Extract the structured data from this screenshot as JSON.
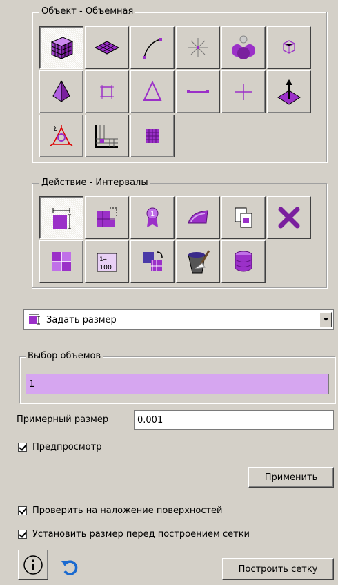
{
  "object_group": {
    "title": "Объект - Объемная",
    "tools": [
      {
        "name": "volume-cube-icon",
        "active": true
      },
      {
        "name": "surface-icon",
        "active": false
      },
      {
        "name": "curve-icon",
        "active": false
      },
      {
        "name": "vertex-icon",
        "active": false
      },
      {
        "name": "group-icon",
        "active": false
      },
      {
        "name": "polyhedron-icon",
        "active": false
      },
      {
        "name": "cone-icon",
        "active": false
      },
      {
        "name": "square-icon",
        "active": false
      },
      {
        "name": "triangle-icon",
        "active": false
      },
      {
        "name": "edge-icon",
        "active": false
      },
      {
        "name": "node-icon",
        "active": false
      },
      {
        "name": "extrude-icon",
        "active": false
      },
      {
        "name": "sum-triangle-icon",
        "active": false
      },
      {
        "name": "mesh-corner-icon",
        "active": false
      },
      {
        "name": "grid-icon",
        "active": false
      }
    ]
  },
  "action_group": {
    "title": "Действие - Интервалы",
    "tools": [
      {
        "name": "set-size-icon",
        "active": true
      },
      {
        "name": "split-block-icon",
        "active": false
      },
      {
        "name": "badge-icon",
        "active": false
      },
      {
        "name": "iron-icon",
        "active": false
      },
      {
        "name": "copy-icon",
        "active": false
      },
      {
        "name": "delete-x-icon",
        "active": false
      },
      {
        "name": "quadrants-icon",
        "active": false
      },
      {
        "name": "interval-count-icon",
        "active": false
      },
      {
        "name": "transfer-icon",
        "active": false
      },
      {
        "name": "brush-bucket-icon",
        "active": false
      },
      {
        "name": "database-icon",
        "active": false
      }
    ],
    "count_label": "1→\n100"
  },
  "operation_select": {
    "value": "Задать размер"
  },
  "volume_select": {
    "title": "Выбор объемов",
    "value": "1"
  },
  "approx_size": {
    "label": "Примерный размер",
    "value": "0.001"
  },
  "preview": {
    "label": "Предпросмотр",
    "checked": true
  },
  "apply_button": "Применить",
  "check_overlap": {
    "label": "Проверить на наложение поверхностей",
    "checked": true
  },
  "set_size_before": {
    "label": "Установить размер перед построением сетки",
    "checked": true
  },
  "build_mesh_button": "Построить сетку",
  "accent": "#9b30c8",
  "selection_color": "#d6a6f0"
}
